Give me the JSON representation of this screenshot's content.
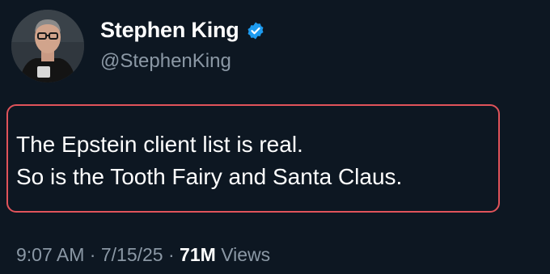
{
  "author": {
    "display_name": "Stephen King",
    "handle": "@StephenKing",
    "verified_icon": "verified-badge-icon",
    "badge_color": "#1d9bf0"
  },
  "tweet": {
    "lines": [
      "The Epstein client list is real.",
      "So is the Tooth Fairy and Santa Claus."
    ],
    "highlight_color": "#e0535a"
  },
  "meta": {
    "time": "9:07 AM",
    "separator": " · ",
    "date": "7/15/25",
    "views_count": "71M",
    "views_label": "Views"
  }
}
